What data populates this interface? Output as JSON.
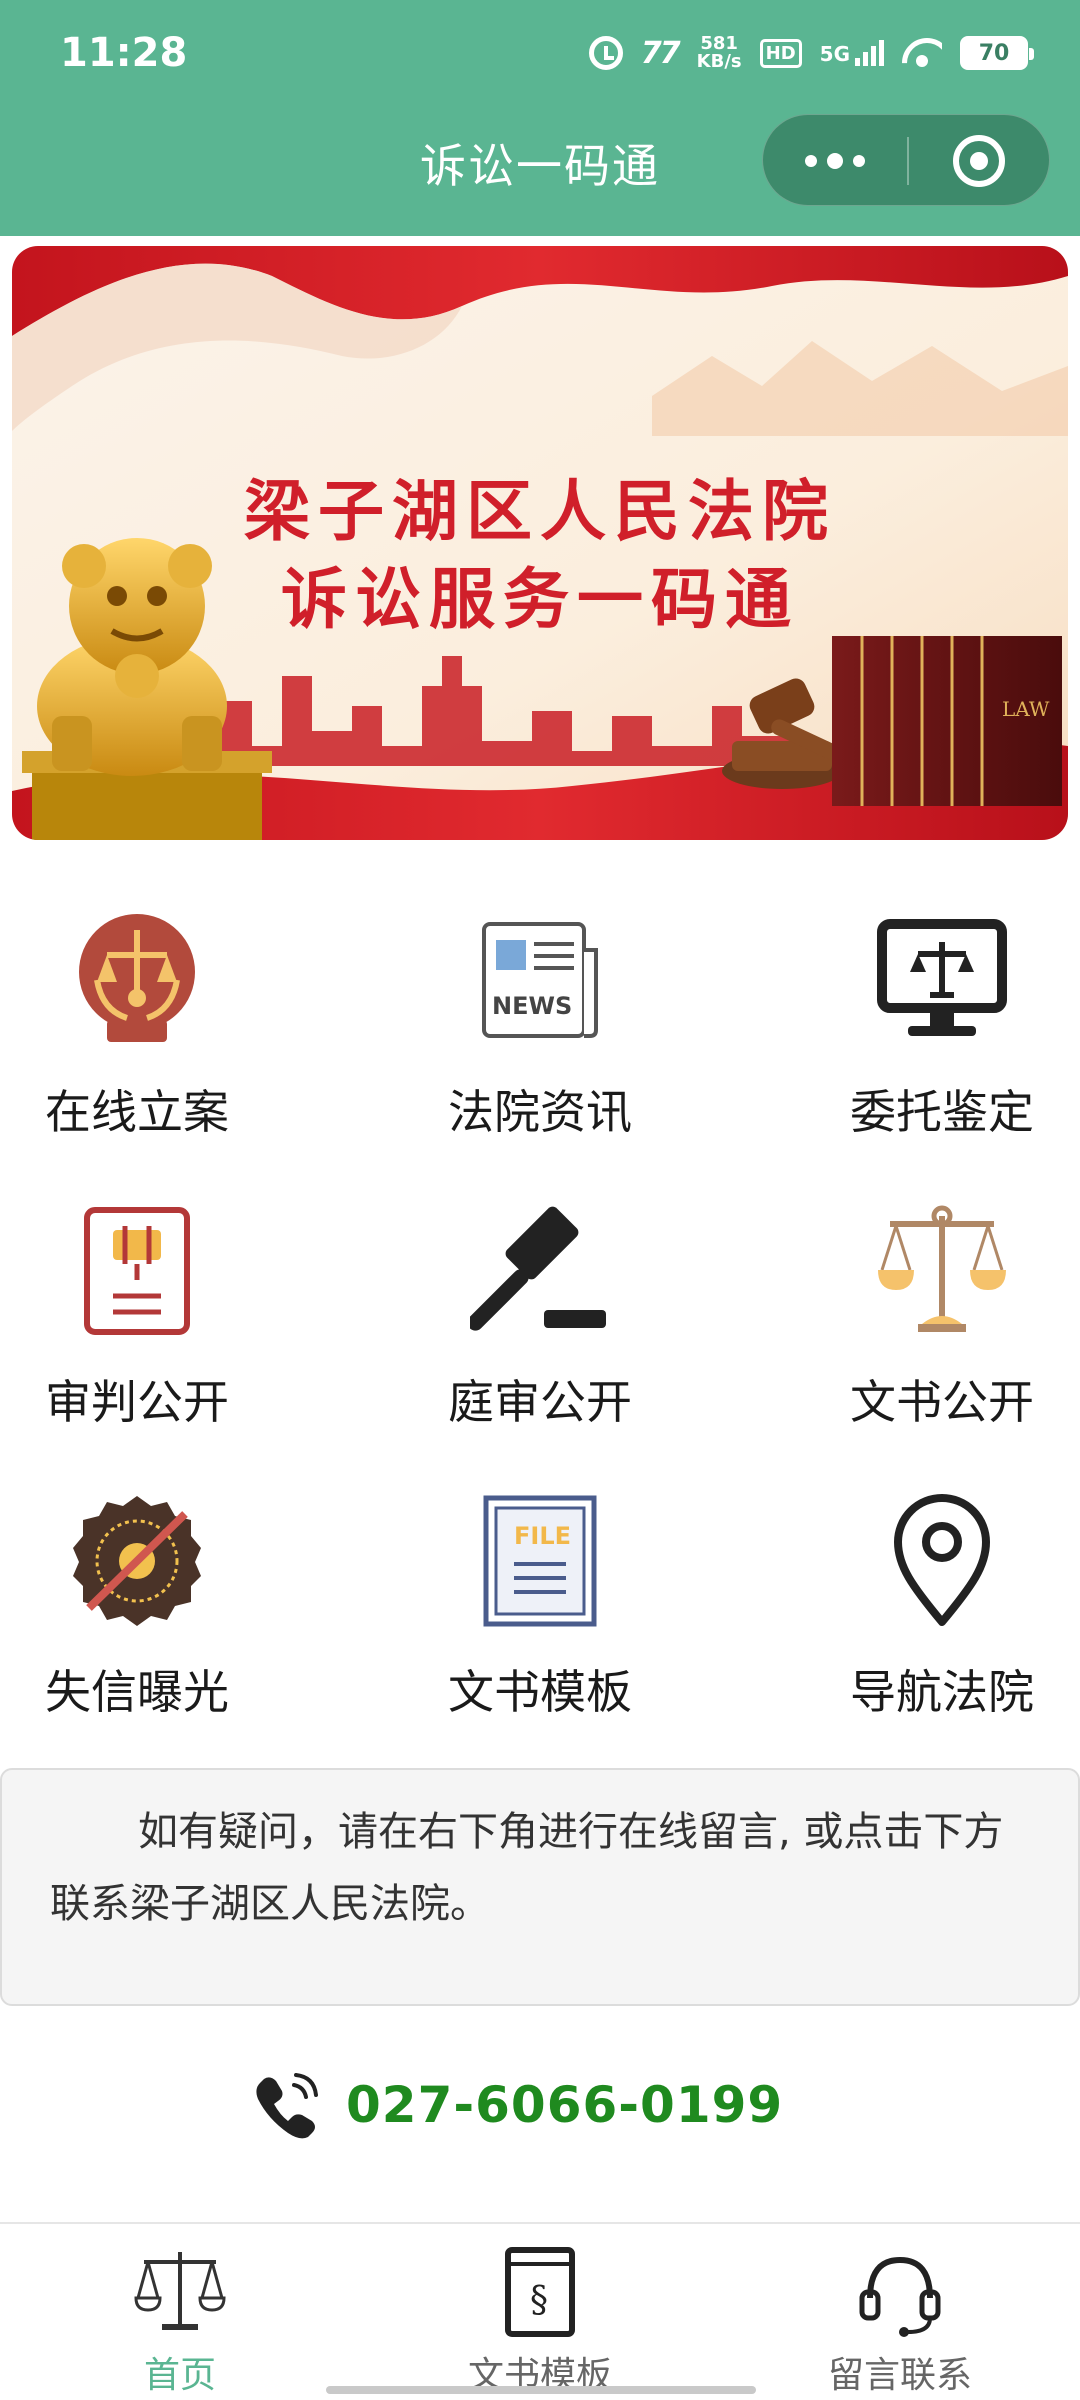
{
  "status_bar": {
    "time": "11:28",
    "icons": [
      "alarm-icon",
      "77-icon",
      "network-speed-icon",
      "hd-icon",
      "5g-signal-icon",
      "wifi-icon",
      "battery-icon"
    ],
    "speed_value": "581",
    "speed_unit": "KB/s",
    "hd_label": "HD",
    "network_label": "5G",
    "carrier_badge": "77",
    "battery_level": "70"
  },
  "nav_bar": {
    "title": "诉讼一码通",
    "capsule": {
      "more_icon": "more-dots-icon",
      "close_icon": "close-miniapp-icon"
    }
  },
  "banner": {
    "line1": "梁子湖区人民法院",
    "line2": "诉讼服务一码通",
    "book_spine_text": "LAW"
  },
  "grid": {
    "items": [
      {
        "label": "在线立案",
        "icon": "court-emblem-icon"
      },
      {
        "label": "法院资讯",
        "icon": "news-icon",
        "icon_text": "NEWS"
      },
      {
        "label": "委托鉴定",
        "icon": "monitor-scale-icon"
      },
      {
        "label": "审判公开",
        "icon": "trial-document-icon"
      },
      {
        "label": "庭审公开",
        "icon": "gavel-icon"
      },
      {
        "label": "文书公开",
        "icon": "balance-scale-icon"
      },
      {
        "label": "失信曝光",
        "icon": "dishonest-seal-icon"
      },
      {
        "label": "文书模板",
        "icon": "file-template-icon",
        "icon_text": "FILE"
      },
      {
        "label": "导航法院",
        "icon": "location-pin-icon"
      }
    ]
  },
  "notice": {
    "text": "如有疑问，请在右下角进行在线留言, 或点击下方联系梁子湖区人民法院。"
  },
  "contact": {
    "icon": "phone-icon",
    "phone": "027-6066-0199"
  },
  "tab_bar": {
    "tabs": [
      {
        "label": "首页",
        "icon": "scale-tab-icon",
        "active": true
      },
      {
        "label": "文书模板",
        "icon": "section-book-icon",
        "active": false
      },
      {
        "label": "留言联系",
        "icon": "headset-icon",
        "active": false
      }
    ]
  },
  "colors": {
    "primary_green": "#5ab592",
    "capsule_green": "#3d8a6b",
    "banner_red": "#d01f2a",
    "phone_green": "#1f8a1f",
    "notice_bg": "#f5f5f5"
  }
}
